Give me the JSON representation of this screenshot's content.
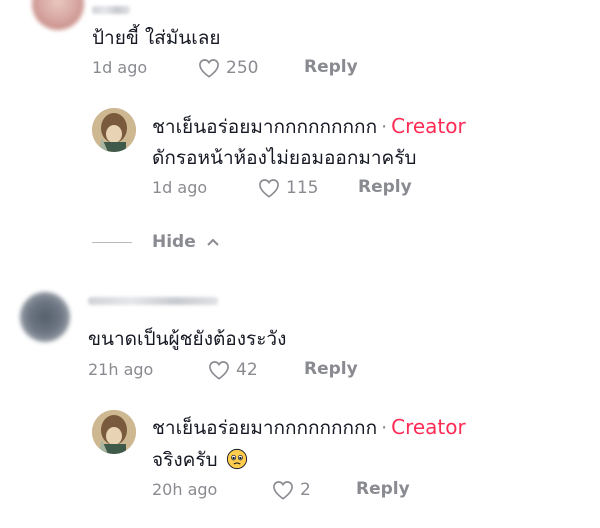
{
  "comment1": {
    "text": "ป้ายขี้ ใส่มันเลย",
    "time": "1d ago",
    "likes": "250",
    "reply_label": "Reply"
  },
  "reply1": {
    "author": "ชาเย็นอร่อยมากกกกกกกกก",
    "separator": "·",
    "badge": "Creator",
    "text": "ดักรอหน้าห้องไม่ยอมออกมาครับ",
    "time": "1d ago",
    "likes": "115",
    "reply_label": "Reply"
  },
  "hide_label": "Hide",
  "comment2": {
    "text": "ขนาดเป็นผู้ชยังต้องระวัง",
    "time": "21h ago",
    "likes": "42",
    "reply_label": "Reply"
  },
  "reply2": {
    "author": "ชาเย็นอร่อยมากกกกกกกกก",
    "separator": "·",
    "badge": "Creator",
    "text": "จริงครับ",
    "emoji": "pleading-face",
    "time": "20h ago",
    "likes": "2",
    "reply_label": "Reply"
  },
  "colors": {
    "creator_badge": "#fe2c55",
    "meta_gray": "#8a8b91",
    "text": "#161823"
  }
}
